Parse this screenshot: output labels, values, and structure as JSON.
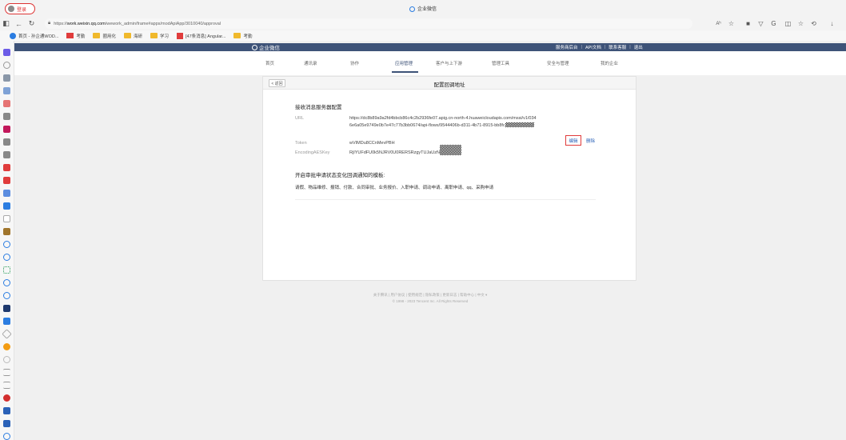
{
  "browser": {
    "profile_label": "登录",
    "tab_title": "企业微信",
    "url_prefix": "https://",
    "url_host": "work.weixin.qq.com",
    "url_path": "/wework_admin/frame#apps/modApiApp/3010040/approval",
    "read_aloud": "Aʰ",
    "bookmarks": [
      "首页 - 孙企通WOD...",
      "考勤",
      "圈用化",
      "海研",
      "学习",
      "[47条消息] Angular...",
      "考勤"
    ]
  },
  "colors": {
    "nav_bg": "#3e5378",
    "accent_red": "#e03c3c",
    "link_blue": "#2b62b8"
  },
  "topnav": {
    "brand": "企业微信",
    "links": [
      "服务商后台",
      "API文档",
      "联系客服",
      "退出"
    ]
  },
  "menu": {
    "items": [
      "首页",
      "通讯录",
      "协作",
      "应用管理",
      "客户与上下游",
      "管理工具",
      "安全与管理",
      "我的企业"
    ],
    "active": "应用管理"
  },
  "page": {
    "back": "< 返回",
    "title": "配置回调地址",
    "section1": "接收消息服务器配置",
    "url_label": "URL",
    "url_value": "https://dc8b89a9a2fd4bbcb86c4c2b2936fe07.apig.cn-north-4.huaweicloudapis.com/mssi/v1/0346e6a05e9749e0b7e47c77b3bb0674/api-flows/9544406b-d311-4b71-8915-bb8fc",
    "token_label": "Token",
    "token_value": "wVIMDu8CCnMevPBH",
    "aes_label": "EncodingAESKey",
    "aes_value": "RjIYUFdFU0k5NJRV0U0RERSRzgyTUJaUzN",
    "edit": "编辑",
    "delete": "删除",
    "section2": "开启审批申请状态变化回调通知的模板:",
    "templates": "请假、物品维修、报销、付款、合同审批、业务报价、入职申请、调动申请、离职申请、qq、采购申请"
  },
  "footer": {
    "links": "关于腾讯 | 用户协议 | 使用规范 | 隐私政策 | 更新日志 | 帮助中心 | 中文 ▾",
    "copyright": "© 1998 - 2023 Tencent Inc. All Rights Reserved"
  }
}
